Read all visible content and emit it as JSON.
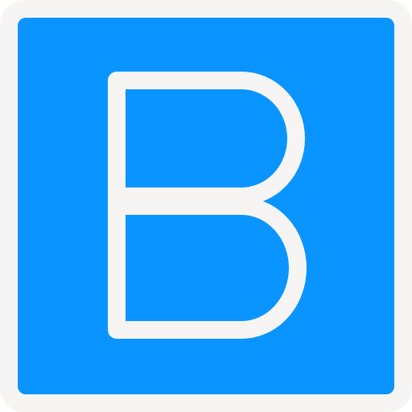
{
  "icon": {
    "name": "bold-b-icon",
    "letter": "B",
    "colors": {
      "frame": "#F6F5F3",
      "background": "#0A94FF",
      "glyph": "#F6F5F3"
    }
  }
}
